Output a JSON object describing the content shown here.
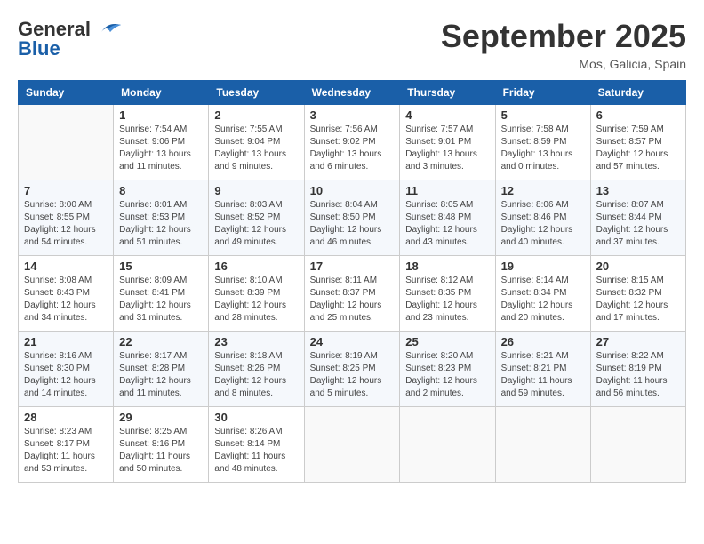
{
  "header": {
    "logo_line1": "General",
    "logo_line2": "Blue",
    "month_title": "September 2025",
    "subtitle": "Mos, Galicia, Spain"
  },
  "days_of_week": [
    "Sunday",
    "Monday",
    "Tuesday",
    "Wednesday",
    "Thursday",
    "Friday",
    "Saturday"
  ],
  "weeks": [
    [
      {
        "day": "",
        "sunrise": "",
        "sunset": "",
        "daylight": ""
      },
      {
        "day": "1",
        "sunrise": "Sunrise: 7:54 AM",
        "sunset": "Sunset: 9:06 PM",
        "daylight": "Daylight: 13 hours and 11 minutes."
      },
      {
        "day": "2",
        "sunrise": "Sunrise: 7:55 AM",
        "sunset": "Sunset: 9:04 PM",
        "daylight": "Daylight: 13 hours and 9 minutes."
      },
      {
        "day": "3",
        "sunrise": "Sunrise: 7:56 AM",
        "sunset": "Sunset: 9:02 PM",
        "daylight": "Daylight: 13 hours and 6 minutes."
      },
      {
        "day": "4",
        "sunrise": "Sunrise: 7:57 AM",
        "sunset": "Sunset: 9:01 PM",
        "daylight": "Daylight: 13 hours and 3 minutes."
      },
      {
        "day": "5",
        "sunrise": "Sunrise: 7:58 AM",
        "sunset": "Sunset: 8:59 PM",
        "daylight": "Daylight: 13 hours and 0 minutes."
      },
      {
        "day": "6",
        "sunrise": "Sunrise: 7:59 AM",
        "sunset": "Sunset: 8:57 PM",
        "daylight": "Daylight: 12 hours and 57 minutes."
      }
    ],
    [
      {
        "day": "7",
        "sunrise": "Sunrise: 8:00 AM",
        "sunset": "Sunset: 8:55 PM",
        "daylight": "Daylight: 12 hours and 54 minutes."
      },
      {
        "day": "8",
        "sunrise": "Sunrise: 8:01 AM",
        "sunset": "Sunset: 8:53 PM",
        "daylight": "Daylight: 12 hours and 51 minutes."
      },
      {
        "day": "9",
        "sunrise": "Sunrise: 8:03 AM",
        "sunset": "Sunset: 8:52 PM",
        "daylight": "Daylight: 12 hours and 49 minutes."
      },
      {
        "day": "10",
        "sunrise": "Sunrise: 8:04 AM",
        "sunset": "Sunset: 8:50 PM",
        "daylight": "Daylight: 12 hours and 46 minutes."
      },
      {
        "day": "11",
        "sunrise": "Sunrise: 8:05 AM",
        "sunset": "Sunset: 8:48 PM",
        "daylight": "Daylight: 12 hours and 43 minutes."
      },
      {
        "day": "12",
        "sunrise": "Sunrise: 8:06 AM",
        "sunset": "Sunset: 8:46 PM",
        "daylight": "Daylight: 12 hours and 40 minutes."
      },
      {
        "day": "13",
        "sunrise": "Sunrise: 8:07 AM",
        "sunset": "Sunset: 8:44 PM",
        "daylight": "Daylight: 12 hours and 37 minutes."
      }
    ],
    [
      {
        "day": "14",
        "sunrise": "Sunrise: 8:08 AM",
        "sunset": "Sunset: 8:43 PM",
        "daylight": "Daylight: 12 hours and 34 minutes."
      },
      {
        "day": "15",
        "sunrise": "Sunrise: 8:09 AM",
        "sunset": "Sunset: 8:41 PM",
        "daylight": "Daylight: 12 hours and 31 minutes."
      },
      {
        "day": "16",
        "sunrise": "Sunrise: 8:10 AM",
        "sunset": "Sunset: 8:39 PM",
        "daylight": "Daylight: 12 hours and 28 minutes."
      },
      {
        "day": "17",
        "sunrise": "Sunrise: 8:11 AM",
        "sunset": "Sunset: 8:37 PM",
        "daylight": "Daylight: 12 hours and 25 minutes."
      },
      {
        "day": "18",
        "sunrise": "Sunrise: 8:12 AM",
        "sunset": "Sunset: 8:35 PM",
        "daylight": "Daylight: 12 hours and 23 minutes."
      },
      {
        "day": "19",
        "sunrise": "Sunrise: 8:14 AM",
        "sunset": "Sunset: 8:34 PM",
        "daylight": "Daylight: 12 hours and 20 minutes."
      },
      {
        "day": "20",
        "sunrise": "Sunrise: 8:15 AM",
        "sunset": "Sunset: 8:32 PM",
        "daylight": "Daylight: 12 hours and 17 minutes."
      }
    ],
    [
      {
        "day": "21",
        "sunrise": "Sunrise: 8:16 AM",
        "sunset": "Sunset: 8:30 PM",
        "daylight": "Daylight: 12 hours and 14 minutes."
      },
      {
        "day": "22",
        "sunrise": "Sunrise: 8:17 AM",
        "sunset": "Sunset: 8:28 PM",
        "daylight": "Daylight: 12 hours and 11 minutes."
      },
      {
        "day": "23",
        "sunrise": "Sunrise: 8:18 AM",
        "sunset": "Sunset: 8:26 PM",
        "daylight": "Daylight: 12 hours and 8 minutes."
      },
      {
        "day": "24",
        "sunrise": "Sunrise: 8:19 AM",
        "sunset": "Sunset: 8:25 PM",
        "daylight": "Daylight: 12 hours and 5 minutes."
      },
      {
        "day": "25",
        "sunrise": "Sunrise: 8:20 AM",
        "sunset": "Sunset: 8:23 PM",
        "daylight": "Daylight: 12 hours and 2 minutes."
      },
      {
        "day": "26",
        "sunrise": "Sunrise: 8:21 AM",
        "sunset": "Sunset: 8:21 PM",
        "daylight": "Daylight: 11 hours and 59 minutes."
      },
      {
        "day": "27",
        "sunrise": "Sunrise: 8:22 AM",
        "sunset": "Sunset: 8:19 PM",
        "daylight": "Daylight: 11 hours and 56 minutes."
      }
    ],
    [
      {
        "day": "28",
        "sunrise": "Sunrise: 8:23 AM",
        "sunset": "Sunset: 8:17 PM",
        "daylight": "Daylight: 11 hours and 53 minutes."
      },
      {
        "day": "29",
        "sunrise": "Sunrise: 8:25 AM",
        "sunset": "Sunset: 8:16 PM",
        "daylight": "Daylight: 11 hours and 50 minutes."
      },
      {
        "day": "30",
        "sunrise": "Sunrise: 8:26 AM",
        "sunset": "Sunset: 8:14 PM",
        "daylight": "Daylight: 11 hours and 48 minutes."
      },
      {
        "day": "",
        "sunrise": "",
        "sunset": "",
        "daylight": ""
      },
      {
        "day": "",
        "sunrise": "",
        "sunset": "",
        "daylight": ""
      },
      {
        "day": "",
        "sunrise": "",
        "sunset": "",
        "daylight": ""
      },
      {
        "day": "",
        "sunrise": "",
        "sunset": "",
        "daylight": ""
      }
    ]
  ]
}
